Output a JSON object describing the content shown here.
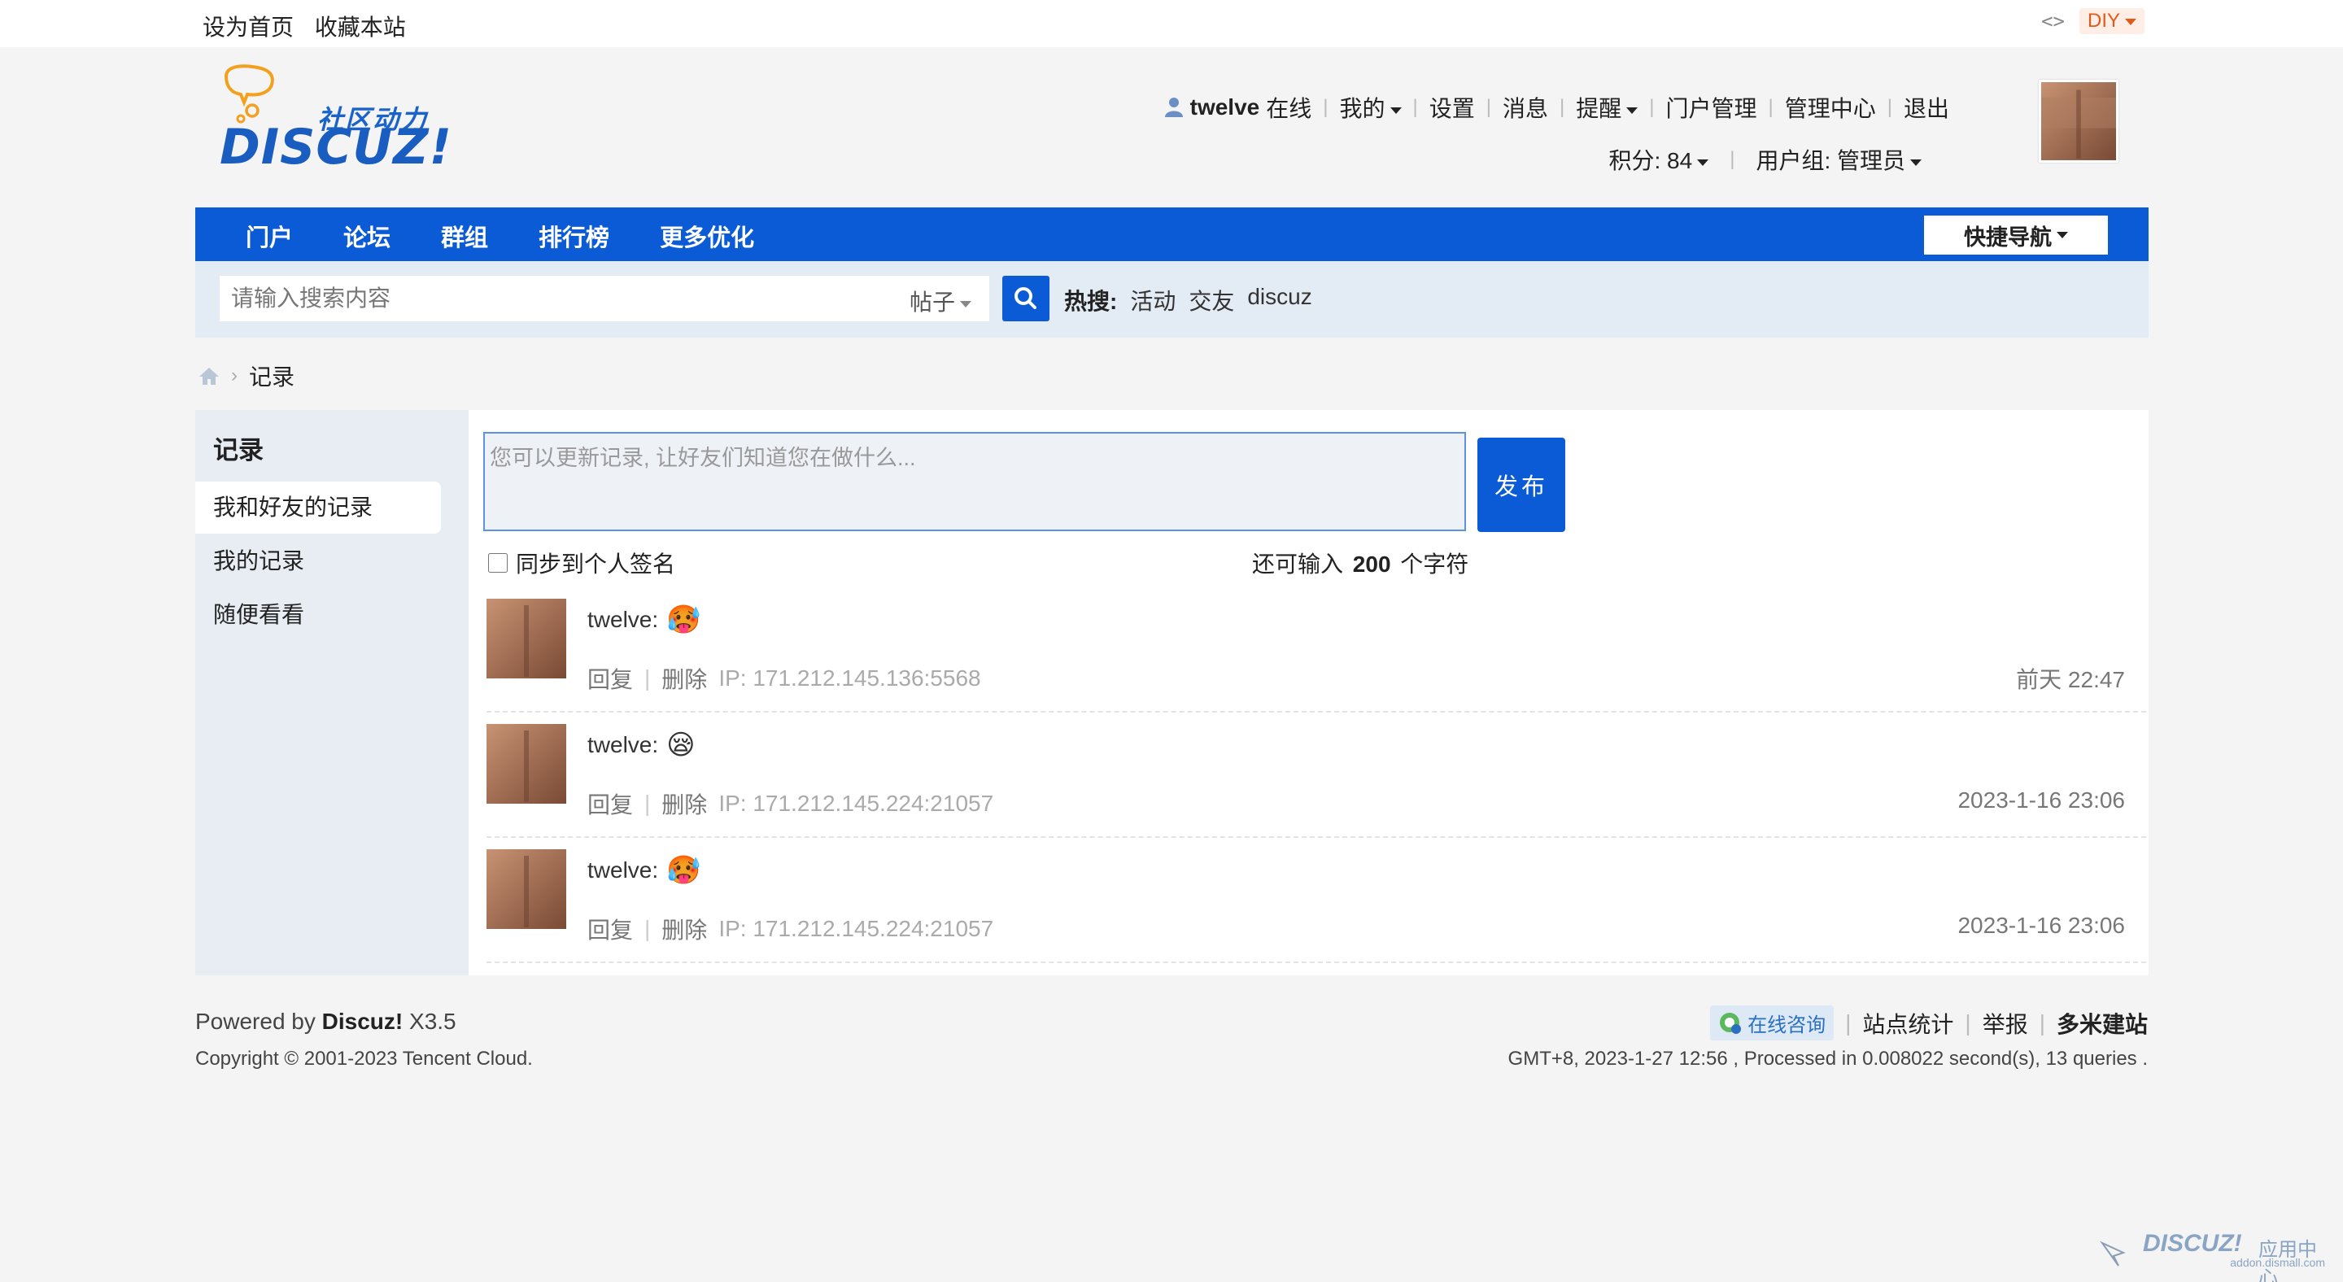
{
  "topbar": {
    "links": [
      "设为首页",
      "收藏本站"
    ],
    "code_icon": "<>",
    "diy_label": "DIY"
  },
  "header": {
    "logo": {
      "tagline": "社区动力",
      "wordmark": "DISCUZ!"
    },
    "user": {
      "name": "twelve",
      "status": "在线",
      "menu": [
        "我的",
        "设置",
        "消息",
        "提醒",
        "门户管理",
        "管理中心",
        "退出"
      ],
      "points": "积分: 84",
      "group": "用户组: 管理员"
    }
  },
  "nav": {
    "items": [
      "门户",
      "论坛",
      "群组",
      "排行榜",
      "更多优化"
    ],
    "quick_nav": "快捷导航"
  },
  "search": {
    "placeholder": "请输入搜索内容",
    "type": "帖子",
    "hot_label": "热搜:",
    "hot_terms": [
      "活动",
      "交友",
      "discuz"
    ]
  },
  "breadcrumb": {
    "current": "记录"
  },
  "sidebar": {
    "title": "记录",
    "items": [
      {
        "label": "我和好友的记录",
        "active": true
      },
      {
        "label": "我的记录",
        "active": false
      },
      {
        "label": "随便看看",
        "active": false
      }
    ]
  },
  "composer": {
    "placeholder": "您可以更新记录, 让好友们知道您在做什么...",
    "submit": "发布",
    "sync_label": "同步到个人签名",
    "remain_prefix": "还可输入",
    "remain_count": "200",
    "remain_suffix": "个字符"
  },
  "records": [
    {
      "author": "twelve:",
      "emoji": "🥵",
      "reply": "回复",
      "delete": "删除",
      "ip": "IP: 171.212.145.136:5568",
      "time": "前天 22:47"
    },
    {
      "author": "twelve:",
      "emoji": "😪",
      "reply": "回复",
      "delete": "删除",
      "ip": "IP: 171.212.145.224:21057",
      "time": "2023-1-16 23:06"
    },
    {
      "author": "twelve:",
      "emoji": "🥵",
      "reply": "回复",
      "delete": "删除",
      "ip": "IP: 171.212.145.224:21057",
      "time": "2023-1-16 23:06"
    }
  ],
  "footer": {
    "powered_prefix": "Powered by",
    "powered_brand": "Discuz!",
    "powered_version": "X3.5",
    "copyright": "Copyright © 2001-2023 Tencent Cloud.",
    "consult": "在线咨询",
    "links": [
      "站点统计",
      "举报",
      "多米建站"
    ],
    "stats": "GMT+8, 2023-1-27 12:56 , Processed in 0.008022 second(s), 13 queries ."
  },
  "watermark": {
    "brand": "DISCUZ!",
    "label": "应用中心",
    "domain": "addon.dismall.com"
  },
  "colors": {
    "primary": "#0b5bd6",
    "search_band": "#e3ebf5",
    "sidebar": "#e8edf3",
    "diy": "#e05a1a"
  }
}
